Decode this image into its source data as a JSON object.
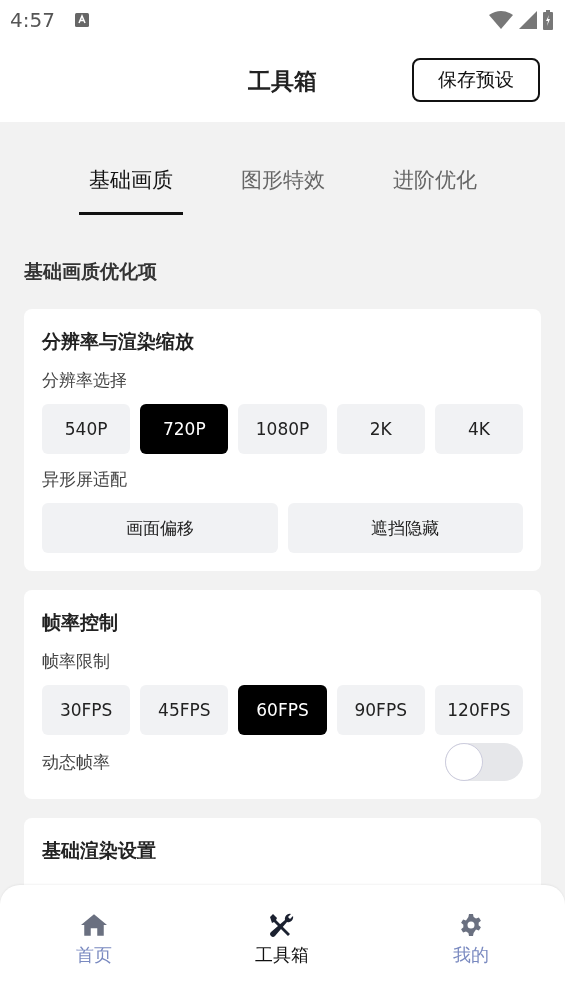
{
  "status_bar": {
    "time": "4:57"
  },
  "header": {
    "title": "工具箱",
    "action": "保存预设"
  },
  "tabs": [
    {
      "label": "基础画质",
      "selected": true
    },
    {
      "label": "图形特效",
      "selected": false
    },
    {
      "label": "进阶优化",
      "selected": false
    }
  ],
  "section_title": "基础画质优化项",
  "cards": [
    {
      "title": "分辨率与渲染缩放",
      "rows": [
        {
          "kind": "options",
          "label": "分辨率选择",
          "options": [
            {
              "label": "540P",
              "selected": false
            },
            {
              "label": "720P",
              "selected": true
            },
            {
              "label": "1080P",
              "selected": false
            },
            {
              "label": "2K",
              "selected": false
            },
            {
              "label": "4K",
              "selected": false
            }
          ]
        },
        {
          "kind": "options",
          "label": "异形屏适配",
          "options": [
            {
              "label": "画面偏移",
              "selected": false
            },
            {
              "label": "遮挡隐藏",
              "selected": false
            }
          ]
        }
      ]
    },
    {
      "title": "帧率控制",
      "rows": [
        {
          "kind": "options",
          "label": "帧率限制",
          "options": [
            {
              "label": "30FPS",
              "selected": false
            },
            {
              "label": "45FPS",
              "selected": false
            },
            {
              "label": "60FPS",
              "selected": true
            },
            {
              "label": "90FPS",
              "selected": false
            },
            {
              "label": "120FPS",
              "selected": false
            }
          ]
        },
        {
          "kind": "toggle",
          "label": "动态帧率",
          "on": false
        }
      ]
    },
    {
      "title": "基础渲染设置"
    }
  ],
  "bottom_nav": [
    {
      "label": "首页",
      "kind": "home",
      "selected": false
    },
    {
      "label": "工具箱",
      "kind": "tools",
      "selected": true
    },
    {
      "label": "我的",
      "kind": "gear",
      "selected": false
    }
  ]
}
